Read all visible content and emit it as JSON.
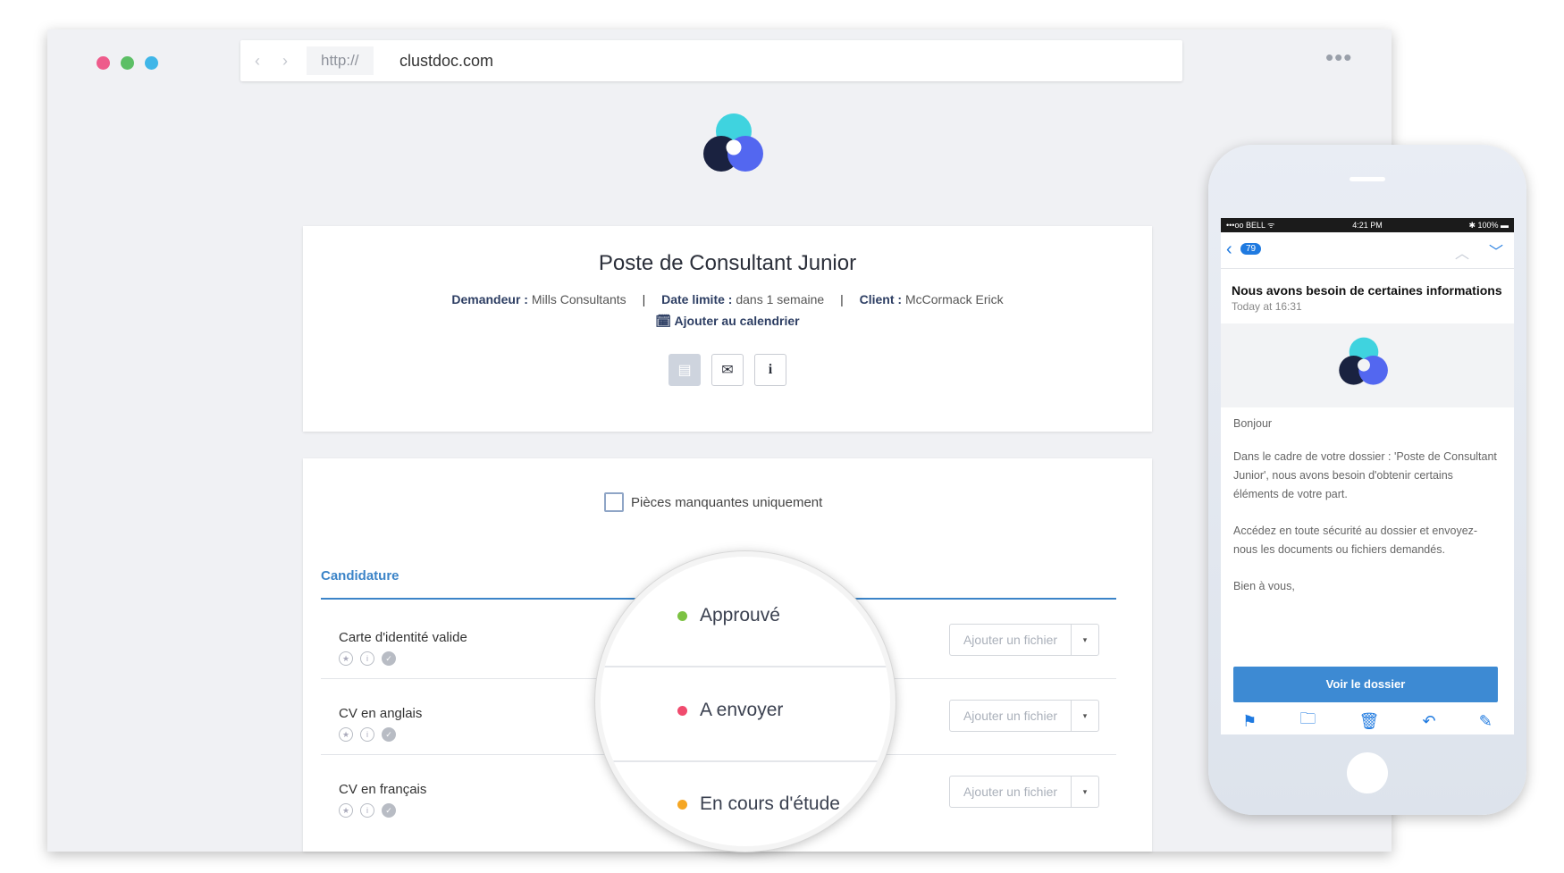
{
  "browser": {
    "dots": [
      "#ee5b8b",
      "#5cbf65",
      "#3fb6e8"
    ],
    "nav_arrows": "‹ ›",
    "protocol": "http://",
    "domain": "clustdoc.com",
    "menu": "•••"
  },
  "dossier": {
    "title": "Poste de Consultant Junior",
    "requester_label": "Demandeur :",
    "requester_value": "Mills Consultants",
    "deadline_label": "Date limite :",
    "deadline_value": "dans 1 semaine",
    "client_label": "Client :",
    "client_value": "McCormack Erick",
    "separator": "|",
    "calendar_icon": "calendar-icon",
    "calendar_link": "Ajouter au calendrier",
    "buttons": [
      {
        "icon": "document-icon",
        "glyph": "▤"
      },
      {
        "icon": "mail-icon",
        "glyph": "✉"
      },
      {
        "icon": "info-icon",
        "glyph": "i"
      }
    ]
  },
  "documents": {
    "missing_only_label": "Pièces manquantes uniquement",
    "tab": "Candidature",
    "add_file_label": "Ajouter un fichier",
    "caret": "▾",
    "rows": [
      {
        "label": "Carte d'identité valide"
      },
      {
        "label": "CV en anglais"
      },
      {
        "label": "CV en français"
      }
    ]
  },
  "statuses": [
    {
      "label": "Approuvé",
      "color": "#7cc242"
    },
    {
      "label": "A envoyer",
      "color": "#f04b6e"
    },
    {
      "label": "En cours d'étude",
      "color": "#f5a623"
    }
  ],
  "phone": {
    "status_left": "•••oo BELL ᯤ",
    "status_time": "4:21 PM",
    "status_right": "✱ 100% ▬",
    "back": "‹",
    "unread_count": "79",
    "up": "︿",
    "down": "﹀",
    "subject": "Nous avons besoin de certaines informations",
    "time": "Today at 16:31",
    "greeting": "Bonjour",
    "paragraph1": "Dans le cadre de votre dossier : 'Poste de Consultant Junior', nous avons besoin d'obtenir certains éléments de votre part.",
    "paragraph2": "Accédez en toute sécurité au dossier et envoyez-nous les documents ou fichiers demandés.",
    "signoff": "Bien à vous,",
    "cta": "Voir le dossier",
    "toolbar_icons": [
      "flag-icon",
      "folder-icon",
      "trash-icon",
      "reply-icon",
      "compose-icon"
    ]
  },
  "colors": {
    "accent": "#3b84c8",
    "navy": "#2d3e63",
    "logo_cyan": "#3fd3df",
    "logo_navy": "#1a2240",
    "logo_blue": "#5367f0"
  }
}
